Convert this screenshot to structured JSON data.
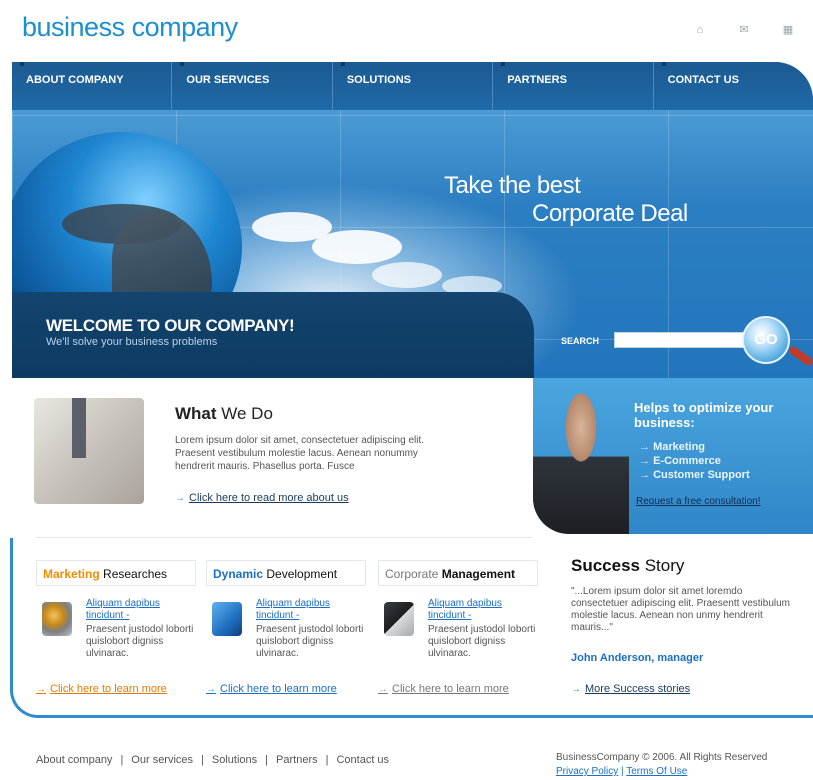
{
  "brand": {
    "logo_text": "business company"
  },
  "top_icons": [
    "home-icon",
    "mail-icon",
    "sitemap-icon"
  ],
  "nav": {
    "items": [
      "ABOUT COMPANY",
      "OUR SERVICES",
      "SOLUTIONS",
      "PARTNERS",
      "CONTACT US"
    ]
  },
  "hero": {
    "tagline_line1": "Take the best",
    "tagline_line2": "Corporate Deal",
    "welcome_title": "WELCOME TO OUR COMPANY!",
    "welcome_sub": "We'll solve your business problems"
  },
  "search": {
    "label": "SEARCH",
    "value": "",
    "button": "GO"
  },
  "what_we_do": {
    "title_bold": "What",
    "title_rest": " We Do",
    "text": "Lorem ipsum dolor sit amet, consectetuer adipiscing elit. Praesent vestibulum molestie lacus. Aenean nonummy hendrerit mauris. Phasellus porta. Fusce",
    "link": "Click here to read more about us"
  },
  "optimize": {
    "heading": "Helps to optimize your business:",
    "items": [
      "Marketing",
      "E-Commerce",
      "Customer Support"
    ],
    "link": "Request a free consultation!"
  },
  "columns": [
    {
      "head_accent": "Marketing",
      "head_rest": " Researches",
      "accent_color": "#f08c00",
      "link": "Aliquam dapibus tincidunt -",
      "body": "Praesent justodol loborti quislobort digniss ulvinarac.",
      "more": "Click here to learn more",
      "more_color": "#e37b00"
    },
    {
      "head_accent": "Dynamic",
      "head_rest": " Development",
      "accent_color": "#1b6fc4",
      "link": "Aliquam dapibus tincidunt -",
      "body": "Praesent justodol loborti quislobort digniss ulvinarac.",
      "more": "Click here to learn more",
      "more_color": "#1b6fc4"
    },
    {
      "head_accent": "Corporate",
      "head_rest": " Management",
      "accent_color": "#777777",
      "link": "Aliquam dapibus tincidunt -",
      "body": "Praesent justodol loborti quislobort digniss ulvinarac.",
      "more": "Click here to learn more",
      "more_color": "#777777"
    }
  ],
  "success": {
    "title_bold": "Success",
    "title_rest": " Story",
    "quote": "\"...Lorem ipsum dolor sit amet loremdo consectetuer adipiscing elit. Praesentt vestibulum molestie lacus. Aenean non unmy hendrerit mauris...\"",
    "author": "John Anderson, manager",
    "more": "More Success stories"
  },
  "footer": {
    "nav": [
      "About company",
      "Our services",
      "Solutions",
      "Partners",
      "Contact us"
    ],
    "separator": "|",
    "copyright": "BusinessCompany © 2006. All Rights Reserved",
    "privacy": "Privacy Policy",
    "terms": "Terms Of Use"
  }
}
